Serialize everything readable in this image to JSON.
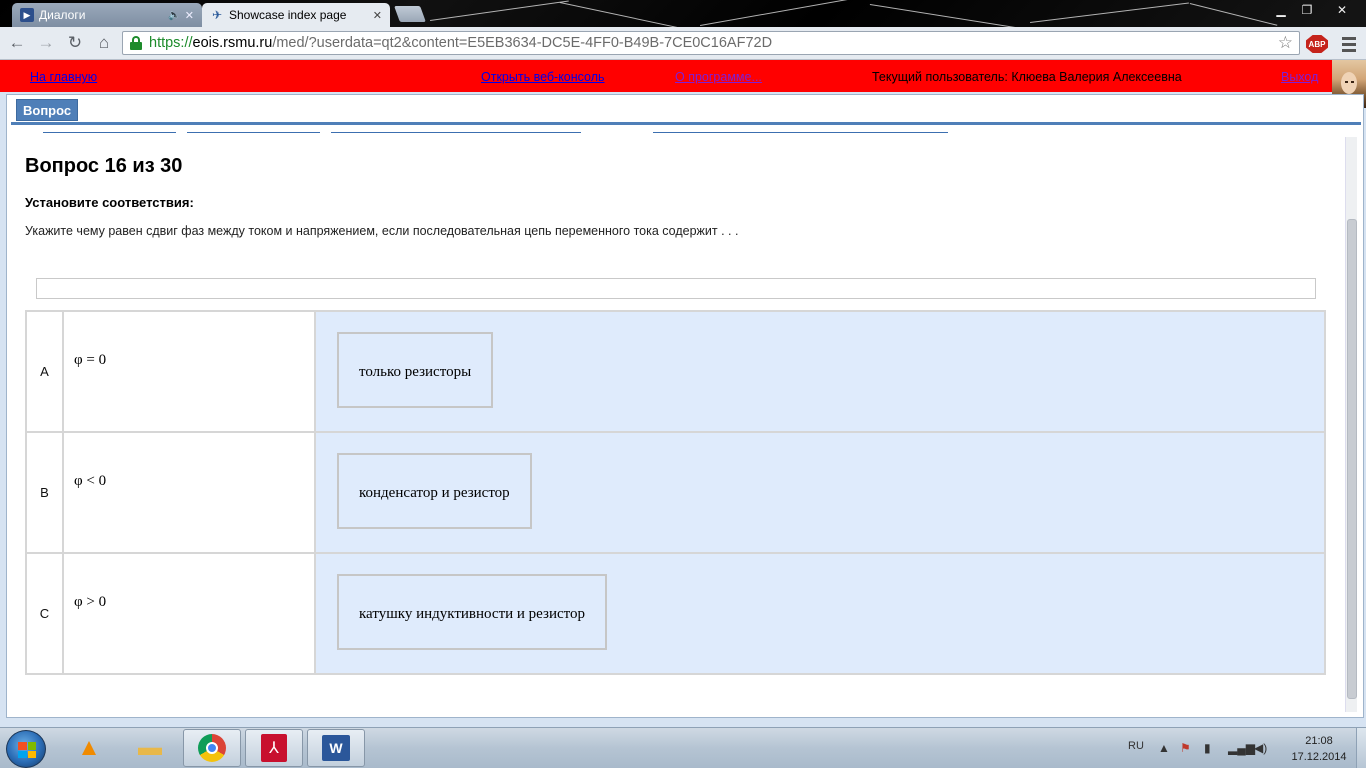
{
  "browser": {
    "tabs": [
      {
        "label": "Диалоги",
        "active": false,
        "icon": "play-icon",
        "has_sound": true
      },
      {
        "label": "Showcase index page",
        "active": true,
        "icon": "jetty-icon"
      }
    ],
    "url": {
      "scheme": "https://",
      "host": "eois.rsmu.ru",
      "path": "/med/?userdata=qt2&content=E5EB3634-DC5E-4FF0-B49B-7CE0C16AF72D"
    },
    "extension_badge": "ABP",
    "accent_secure": "#1d8b2b"
  },
  "topnav": {
    "home": "На главную",
    "web_console": "Открыть веб-консоль",
    "about": "О программе...",
    "current_user": "Текущий пользователь: Клюева Валерия Алексеевна",
    "logout": "Выход",
    "bar_color": "#ff0000"
  },
  "panel": {
    "tab_label": "Вопрос"
  },
  "question": {
    "title": "Вопрос 16 из 30",
    "instruction": "Установите соответствия:",
    "text": "Укажите чему равен сдвиг фаз между током и напряжением, если последовательная цепь переменного тока содержит . . .",
    "rows": [
      {
        "letter": "A",
        "condition": "φ = 0",
        "answer": "только резисторы"
      },
      {
        "letter": "B",
        "condition": "φ < 0",
        "answer": "конденсатор и резистор"
      },
      {
        "letter": "C",
        "condition": "φ > 0",
        "answer": "катушку индуктивности и резистор"
      }
    ]
  },
  "taskbar": {
    "lang": "RU",
    "time": "21:08",
    "date": "17.12.2014"
  }
}
